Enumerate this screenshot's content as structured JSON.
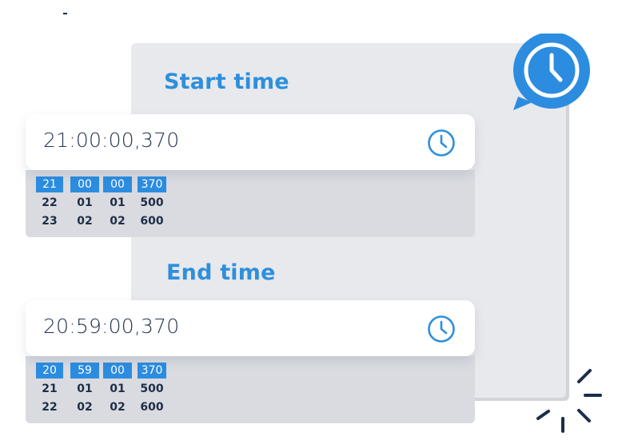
{
  "icons": {
    "badge": "clock-icon",
    "field": "clock-icon",
    "decoration": "sparkle-lines"
  },
  "colors": {
    "accent": "#2e8fdc",
    "selected_cell": "#2c8de0",
    "panel": "#e8e9ed",
    "dropdown": "#d9dbe1",
    "text": "#24354f"
  },
  "start": {
    "title": "Start time",
    "value": "21:00:00,370",
    "columns": [
      [
        "21",
        "22",
        "23"
      ],
      [
        "00",
        "01",
        "02"
      ],
      [
        "00",
        "01",
        "02"
      ],
      [
        "370",
        "500",
        "600"
      ]
    ]
  },
  "end": {
    "title": "End time",
    "value": "20:59:00,370",
    "columns": [
      [
        "20",
        "21",
        "22"
      ],
      [
        "59",
        "01",
        "02"
      ],
      [
        "00",
        "01",
        "02"
      ],
      [
        "370",
        "500",
        "600"
      ]
    ]
  }
}
